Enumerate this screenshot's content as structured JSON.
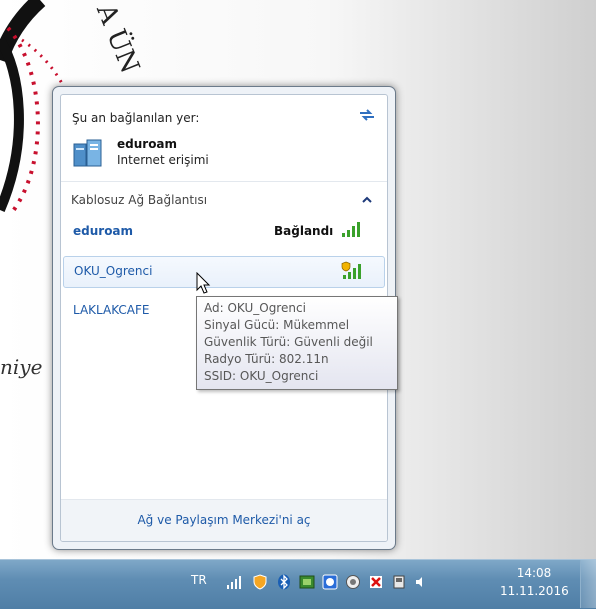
{
  "flyout": {
    "connected_header": "Şu an bağlanılan yer:",
    "current": {
      "name": "eduroam",
      "status": "Internet erişimi"
    },
    "section_title": "Kablosuz Ağ Bağlantısı",
    "networks": [
      {
        "name": "eduroam",
        "status": "Bağlandı",
        "signal": "full",
        "secured": true
      },
      {
        "name": "OKU_Ogrenci",
        "status": "",
        "signal": "full",
        "secured": false
      },
      {
        "name": "LAKLAKCAFE",
        "status": "",
        "signal": "partial",
        "secured": true
      }
    ],
    "footer_link": "Ağ ve Paylaşım Merkezi'ni aç"
  },
  "tooltip": {
    "line1": "Ad: OKU_Ogrenci",
    "line2": "Sinyal Gücü: Mükemmel",
    "line3": "Güvenlik Türü: Güvenli değil",
    "line4": "Radyo Türü: 802.11n",
    "line5": "SSID: OKU_Ogrenci"
  },
  "taskbar": {
    "language": "TR",
    "time": "14:08",
    "date": "11.11.2016",
    "tray_icons": [
      "wifi-signal-icon",
      "shield-icon",
      "bluetooth-icon",
      "gpu-icon",
      "network-adapter-icon",
      "sync-icon",
      "flag-error-icon",
      "usb-device-icon",
      "volume-icon"
    ]
  },
  "wallpaper": {
    "seal_text": "A ÜN",
    "side_text": "niye"
  },
  "colors": {
    "link_blue": "#1e5aa8",
    "taskbar_blue": "#5f8db3",
    "signal_green": "#3aa12b"
  }
}
